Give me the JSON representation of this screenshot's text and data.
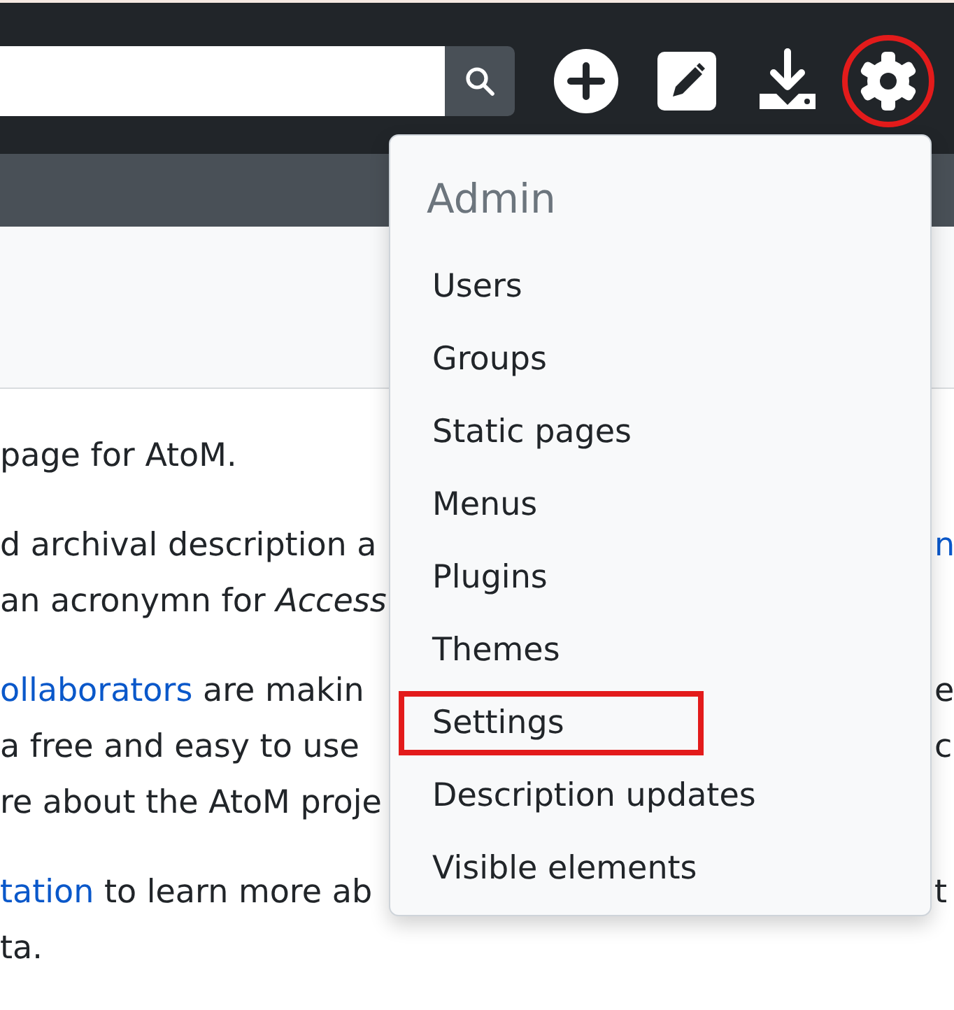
{
  "toolbar": {
    "buttons": [
      {
        "kind": "add",
        "annotated": false
      },
      {
        "kind": "edit",
        "annotated": false
      },
      {
        "kind": "import",
        "annotated": false
      },
      {
        "kind": "settings",
        "annotated": true
      }
    ]
  },
  "content": {
    "paragraphs": [
      {
        "lines": [
          {
            "segments": [
              {
                "kind": "plain",
                "text": "page for AtoM."
              }
            ]
          }
        ]
      },
      {
        "lines": [
          {
            "segments": [
              {
                "kind": "plain",
                "text": "d archival description a"
              }
            ],
            "right": {
              "kind": "link",
              "text": "n"
            }
          },
          {
            "segments": [
              {
                "kind": "plain",
                "text": "an acronymn for "
              },
              {
                "kind": "italic",
                "text": "Access"
              }
            ]
          }
        ]
      },
      {
        "lines": [
          {
            "segments": [
              {
                "kind": "link",
                "text": "ollaborators"
              },
              {
                "kind": "plain",
                "text": " are makin"
              }
            ],
            "right": {
              "kind": "plain",
              "text": "e"
            }
          },
          {
            "segments": [
              {
                "kind": "plain",
                "text": "a free and easy to use"
              }
            ],
            "right": {
              "kind": "plain",
              "text": "c"
            }
          },
          {
            "segments": [
              {
                "kind": "plain",
                "text": "re about the AtoM proje"
              }
            ]
          }
        ]
      },
      {
        "lines": [
          {
            "segments": [
              {
                "kind": "link",
                "text": "tation"
              },
              {
                "kind": "plain",
                "text": " to learn more ab"
              }
            ],
            "right": {
              "kind": "plain",
              "text": "t"
            }
          },
          {
            "segments": [
              {
                "kind": "plain",
                "text": "ta."
              }
            ]
          }
        ]
      }
    ]
  },
  "menu": {
    "title": "Admin",
    "items": [
      {
        "label": "Users",
        "annotated": false
      },
      {
        "label": "Groups",
        "annotated": false
      },
      {
        "label": "Static pages",
        "annotated": false
      },
      {
        "label": "Menus",
        "annotated": false
      },
      {
        "label": "Plugins",
        "annotated": false
      },
      {
        "label": "Themes",
        "annotated": false
      },
      {
        "label": "Settings",
        "annotated": true
      },
      {
        "label": "Description updates",
        "annotated": false
      },
      {
        "label": "Visible elements",
        "annotated": false
      }
    ]
  }
}
